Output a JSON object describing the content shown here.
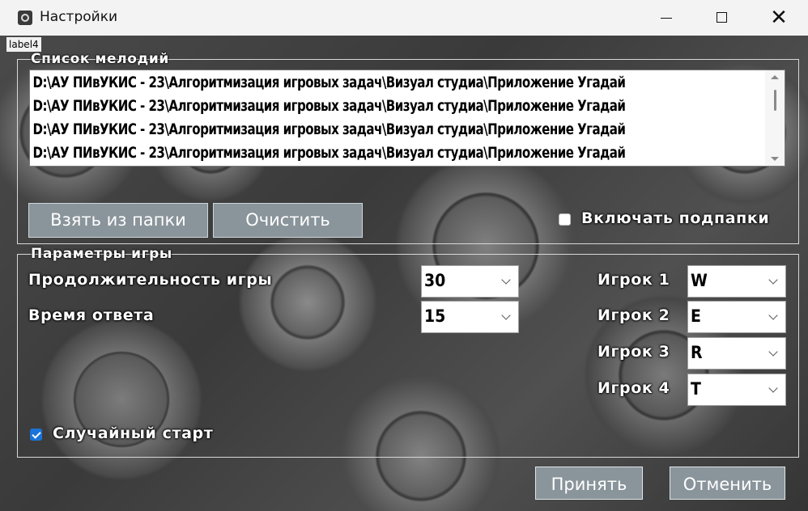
{
  "window": {
    "title": "Настройки"
  },
  "label4": "label4",
  "melodies": {
    "legend": "Список мелодий",
    "items": [
      "D:\\АУ ПИвУКИС - 23\\Алгоритмизация игровых задач\\Визуал студиа\\Приложение Угадай",
      "D:\\АУ ПИвУКИС - 23\\Алгоритмизация игровых задач\\Визуал студиа\\Приложение Угадай",
      "D:\\АУ ПИвУКИС - 23\\Алгоритмизация игровых задач\\Визуал студиа\\Приложение Угадай",
      "D:\\АУ ПИвУКИС - 23\\Алгоритмизация игровых задач\\Визуал студиа\\Приложение Угадай"
    ],
    "take_from_folder_label": "Взять из папки",
    "clear_label": "Очистить",
    "include_subfolders_label": "Включать подпапки",
    "include_subfolders_checked": false
  },
  "params": {
    "legend": "Параметры игры",
    "duration_label": "Продолжительность игры",
    "duration_value": "30",
    "answer_time_label": "Время ответа",
    "answer_time_value": "15",
    "players": [
      {
        "label": "Игрок 1",
        "key": "W"
      },
      {
        "label": "Игрок 2",
        "key": "E"
      },
      {
        "label": "Игрок 3",
        "key": "R"
      },
      {
        "label": "Игрок 4",
        "key": "T"
      }
    ],
    "random_start_label": "Случайный старт",
    "random_start_checked": true
  },
  "footer": {
    "accept_label": "Принять",
    "cancel_label": "Отменить"
  },
  "colors": {
    "button_bg": "#8a949b",
    "checkbox_accent": "#1a73d9",
    "titlebar_bg": "#f3f3f3"
  }
}
